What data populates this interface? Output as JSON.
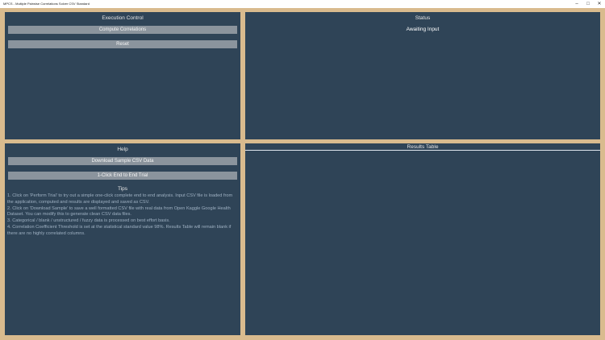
{
  "window": {
    "title": "MPCS - Multiple Pairwise Correlations Solver CSV Standard",
    "minimize": "–",
    "maximize": "□",
    "close": "✕"
  },
  "execution": {
    "title": "Execution Control",
    "compute_label": "Compute Correlations",
    "reset_label": "Reset"
  },
  "status": {
    "title": "Status",
    "value": "Awaiting Input"
  },
  "help": {
    "title": "Help",
    "download_label": "Download Sample CSV Data",
    "trial_label": "1-Click End to End Trial",
    "tips_title": "Tips",
    "tips": [
      "1. Click on 'Perform Trial' to try out a simple one-click complete end to end analysis.  Input CSV file is loaded from the application, computed and results are displayed and saved as CSV.",
      "2. Click on 'Download Sample' to save a well formatted CSV file with real data from Open Kaggle Google Health Dataset.  You can modify this to generate clean CSV data files.",
      "3. Categorical / blank / unstructured / fuzzy data is processed on best effort basis.",
      "4. Correlation Coefficient Threshold is set at the statistical standard value 98%.  Results Table will remain blank if there are no highly correlated columns."
    ]
  },
  "results": {
    "title": "Results Table"
  }
}
